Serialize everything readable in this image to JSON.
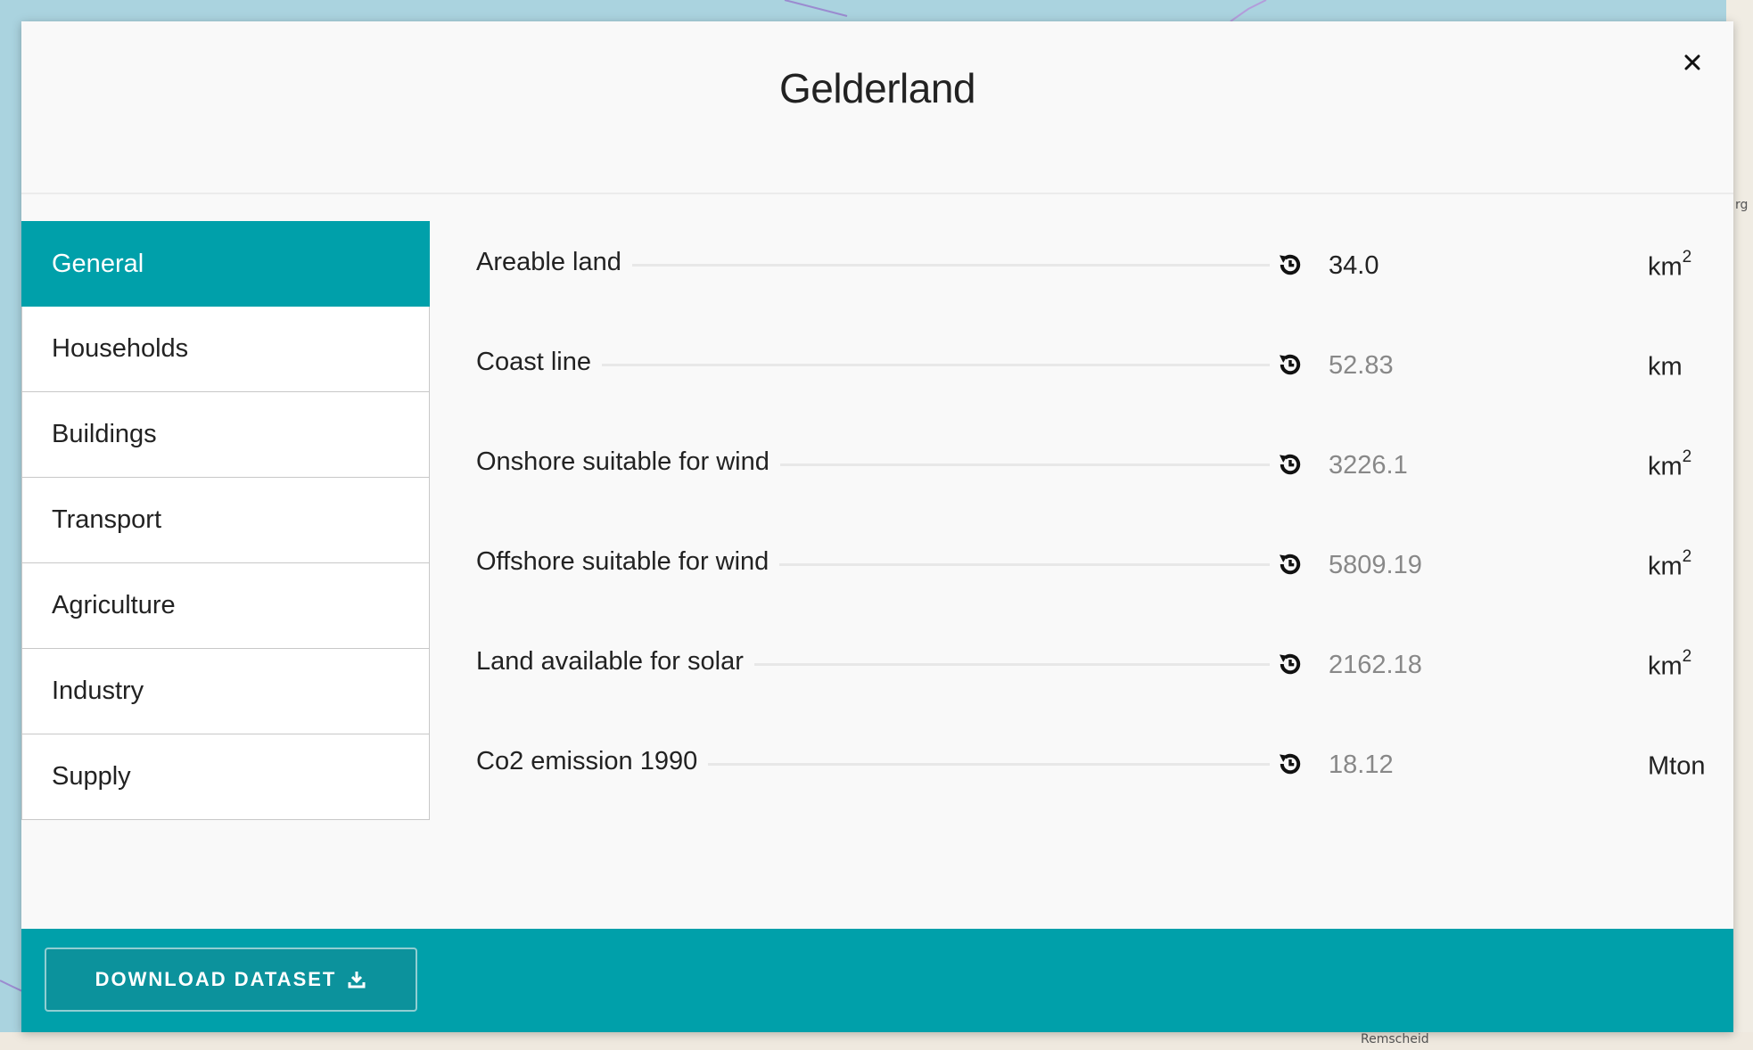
{
  "map": {
    "labels": [
      "Remscheid",
      "rg"
    ]
  },
  "modal": {
    "title": "Gelderland",
    "close_icon": "close-icon"
  },
  "sidebar": {
    "items": [
      {
        "label": "General",
        "active": true
      },
      {
        "label": "Households",
        "active": false
      },
      {
        "label": "Buildings",
        "active": false
      },
      {
        "label": "Transport",
        "active": false
      },
      {
        "label": "Agriculture",
        "active": false
      },
      {
        "label": "Industry",
        "active": false
      },
      {
        "label": "Supply",
        "active": false
      }
    ]
  },
  "rows": [
    {
      "label": "Areable land",
      "value": "34.0",
      "unit": "km",
      "unit_sup": "2",
      "icon": "reset-icon"
    },
    {
      "label": "Coast line",
      "value": "52.83",
      "unit": "km",
      "unit_sup": "",
      "icon": "reset-icon"
    },
    {
      "label": "Onshore suitable for wind",
      "value": "3226.1",
      "unit": "km",
      "unit_sup": "2",
      "icon": "reset-icon"
    },
    {
      "label": "Offshore suitable for wind",
      "value": "5809.19",
      "unit": "km",
      "unit_sup": "2",
      "icon": "reset-icon"
    },
    {
      "label": "Land available for solar",
      "value": "2162.18",
      "unit": "km",
      "unit_sup": "2",
      "icon": "reset-icon"
    },
    {
      "label": "Co2 emission 1990",
      "value": "18.12",
      "unit": "Mton",
      "unit_sup": "",
      "icon": "reset-icon"
    }
  ],
  "footer": {
    "download_label": "DOWNLOAD DATASET",
    "download_icon": "download-icon"
  },
  "colors": {
    "accent": "#00a0aa",
    "map_water": "#aad3df"
  }
}
